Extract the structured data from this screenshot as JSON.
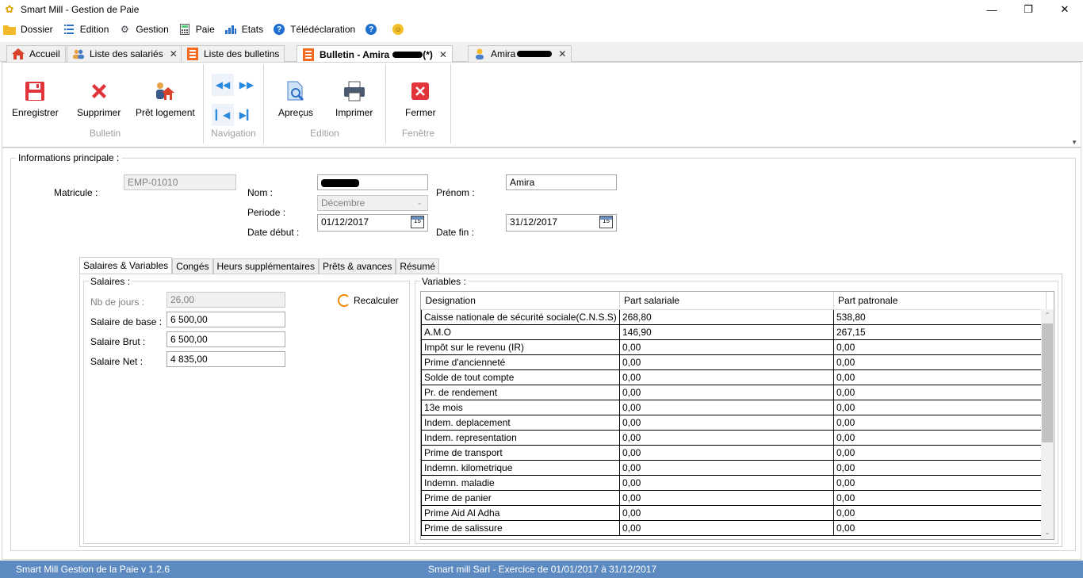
{
  "window": {
    "title": "Smart Mill - Gestion de Paie"
  },
  "menu": [
    {
      "label": "Dossier",
      "icon": "folder-icon"
    },
    {
      "label": "Edition",
      "icon": "list-icon"
    },
    {
      "label": "Gestion",
      "icon": "gear-icon"
    },
    {
      "label": "Paie",
      "icon": "calculator-icon"
    },
    {
      "label": "Etats",
      "icon": "chart-icon"
    },
    {
      "label": "Télédéclaration",
      "icon": "help-icon"
    }
  ],
  "tabs": [
    {
      "label": "Accueil",
      "icon": "home-icon"
    },
    {
      "label": "Liste des salariés",
      "icon": "users-icon"
    },
    {
      "label": "Liste des bulletins",
      "icon": "document-icon"
    },
    {
      "label": "Bulletin - Amira",
      "suffix": "(*)",
      "icon": "document-icon"
    },
    {
      "label": "Amira",
      "icon": "person-icon"
    }
  ],
  "ribbon": {
    "enregistrer": "Enregistrer",
    "supprimer": "Supprimer",
    "pret_logement": "Prêt logement",
    "group_bulletin": "Bulletin",
    "group_navigation": "Navigation",
    "apercus": "Apreçus",
    "imprimer": "Imprimer",
    "group_edition": "Edition",
    "fermer": "Fermer",
    "group_fenetre": "Fenêtre"
  },
  "info": {
    "title": "Informations principale :",
    "matricule_label": "Matricule :",
    "matricule": "EMP-01010",
    "nom_label": "Nom :",
    "prenom_label": "Prénom :",
    "prenom": "Amira",
    "periode_label": "Periode :",
    "periode": "Décembre",
    "date_debut_label": "Date début :",
    "date_debut": "01/12/2017",
    "date_fin_label": "Date fin :",
    "date_fin": "31/12/2017",
    "cal_day": "15"
  },
  "inner_tabs": [
    "Salaires & Variables",
    "Congés",
    "Heurs supplémentaires",
    "Prêts & avances",
    "Résumé"
  ],
  "salaires": {
    "title": "Salaires :",
    "nb_jours_label": "Nb de jours :",
    "nb_jours": "26,00",
    "base_label": "Salaire de base :",
    "base": "6 500,00",
    "brut_label": "Salaire Brut :",
    "brut": "6 500,00",
    "net_label": "Salaire Net :",
    "net": "4 835,00",
    "recalc": "Recalculer"
  },
  "variables": {
    "title": "Variables :",
    "columns": [
      "Designation",
      "Part salariale",
      "Part patronale"
    ],
    "rows": [
      [
        "Caisse nationale de sécurité sociale(C.N.S.S)",
        "268,80",
        "538,80"
      ],
      [
        "A.M.O",
        "146,90",
        "267,15"
      ],
      [
        "Impôt sur le revenu (IR)",
        "0,00",
        "0,00"
      ],
      [
        "Prime d'ancienneté",
        "0,00",
        "0,00"
      ],
      [
        "Solde de tout compte",
        "0,00",
        "0,00"
      ],
      [
        "Pr. de rendement",
        "0,00",
        "0,00"
      ],
      [
        "13e mois",
        "0,00",
        "0,00"
      ],
      [
        "Indem. deplacement",
        "0,00",
        "0,00"
      ],
      [
        "Indem. representation",
        "0,00",
        "0,00"
      ],
      [
        "Prime de transport",
        "0,00",
        "0,00"
      ],
      [
        "Indemn. kilometrique",
        "0,00",
        "0,00"
      ],
      [
        "Indemn. maladie",
        "0,00",
        "0,00"
      ],
      [
        "Prime de panier",
        "0,00",
        "0,00"
      ],
      [
        "Prime Aid Al Adha",
        "0,00",
        "0,00"
      ],
      [
        "Prime de salissure",
        "0,00",
        "0,00"
      ]
    ]
  },
  "status": {
    "left": "Smart Mill Gestion de la Paie v 1.2.6",
    "center": "Smart mill Sarl - Exercice de 01/01/2017 à 31/12/2017"
  },
  "colors": {
    "statusbar": "#5d8bc1",
    "accent": "#2a8ae0"
  }
}
